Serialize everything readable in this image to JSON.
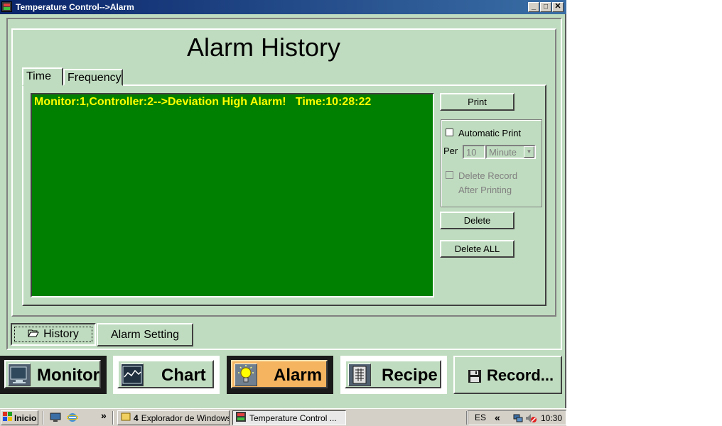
{
  "window": {
    "title": "Temperature Control-->Alarm",
    "minimize_glyph": "_",
    "maximize_glyph": "□",
    "close_glyph": "✕"
  },
  "page": {
    "title": "Alarm History"
  },
  "tabs": [
    {
      "label": "Time",
      "selected": true
    },
    {
      "label": "Frequency",
      "selected": false
    }
  ],
  "alarm_list": {
    "entries": [
      "Monitor:1,Controller:2-->Deviation High Alarm!   Time:10:28:22"
    ]
  },
  "actions": {
    "print_label": "Print",
    "automatic_print_label": "Automatic Print",
    "automatic_print_checked": false,
    "per_label": "Per",
    "per_value": "10",
    "unit_value": "Minute",
    "delete_after_print_line1": "Delete Record",
    "delete_after_print_line2": "After Printing",
    "delete_after_print_checked": false,
    "delete_label": "Delete",
    "delete_all_label": "Delete ALL"
  },
  "bottom_tabs": [
    {
      "label": "History",
      "selected": true,
      "icon": "folder-open-icon"
    },
    {
      "label": "Alarm Setting",
      "selected": false
    }
  ],
  "nav": [
    {
      "label": "Monitor",
      "icon": "monitor-icon",
      "active": false
    },
    {
      "label": "Chart",
      "icon": "chart-icon",
      "active": false
    },
    {
      "label": "Alarm",
      "icon": "lightbulb-icon",
      "active": true
    },
    {
      "label": "Recipe",
      "icon": "recipe-icon",
      "active": false
    },
    {
      "label": "Record...",
      "icon": "floppy-disk-icon",
      "active": false
    }
  ],
  "taskbar": {
    "start_label": "Inicio",
    "overflow_glyph": "»",
    "explorer_count": "4",
    "explorer_label": "Explorador de Windows",
    "active_task_label": "Temperature Control ...",
    "language": "ES",
    "tray_expand_glyph": "«",
    "clock": "10:30"
  },
  "colors": {
    "window_bg": "#c0dcc0",
    "list_bg": "#008000",
    "list_text": "#ffff00",
    "active_nav_bg": "#f4b460"
  }
}
